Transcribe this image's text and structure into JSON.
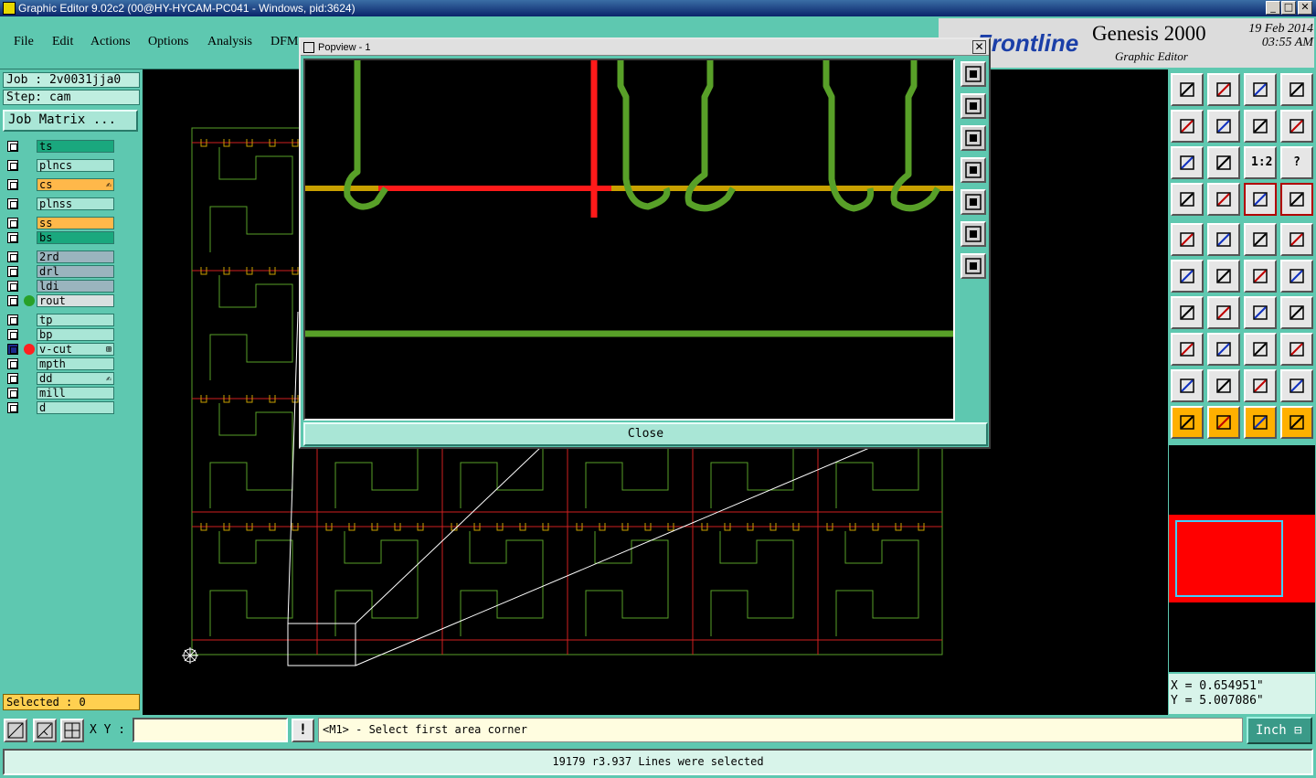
{
  "window": {
    "title": "Graphic Editor 9.02c2 (00@HY-HYCAM-PC041 - Windows, pid:3624)",
    "min_btn": "_",
    "max_btn": "□",
    "close_btn": "✕"
  },
  "menu": [
    "File",
    "Edit",
    "Actions",
    "Options",
    "Analysis",
    "DFM"
  ],
  "logo": {
    "brand": "Frontline",
    "product": "Genesis 2000",
    "subtitle": "Graphic Editor",
    "date": "19 Feb 2014",
    "time": "03:55 AM"
  },
  "job": {
    "job_line": "Job : 2v0031jja0",
    "step_line": "Step: cam",
    "matrix_button": "Job Matrix ..."
  },
  "layers": [
    {
      "name": "ts",
      "color": "#1aa87e",
      "dot": null,
      "flag": ""
    },
    {
      "name": "plncs",
      "color": "#a9e6d6",
      "dot": null,
      "flag": ""
    },
    {
      "name": "cs",
      "color": "#ffb84a",
      "dot": null,
      "flag": "✍"
    },
    {
      "name": "plnss",
      "color": "#a9e6d6",
      "dot": null,
      "flag": ""
    },
    {
      "name": "ss",
      "color": "#ffb84a",
      "dot": null,
      "flag": ""
    },
    {
      "name": "bs",
      "color": "#1aa87e",
      "dot": null,
      "flag": ""
    },
    {
      "name": "2rd",
      "color": "#9ab4be",
      "dot": null,
      "flag": ""
    },
    {
      "name": "drl",
      "color": "#9ab4be",
      "dot": null,
      "flag": ""
    },
    {
      "name": "ldi",
      "color": "#9ab4be",
      "dot": null,
      "flag": ""
    },
    {
      "name": "rout",
      "color": "#d8e0e0",
      "dot": "#28a028",
      "flag": ""
    },
    {
      "name": "tp",
      "color": "#a9e6d6",
      "dot": null,
      "flag": ""
    },
    {
      "name": "bp",
      "color": "#a9e6d6",
      "dot": null,
      "flag": ""
    },
    {
      "name": "v-cut",
      "color": "#a9e6d6",
      "dot": "#ff2020",
      "flag": "⊞"
    },
    {
      "name": "mpth",
      "color": "#a9e6d6",
      "dot": null,
      "flag": ""
    },
    {
      "name": "dd",
      "color": "#a9e6d6",
      "dot": null,
      "flag": "✍"
    },
    {
      "name": "mill",
      "color": "#a9e6d6",
      "dot": null,
      "flag": ""
    },
    {
      "name": "d",
      "color": "#a9e6d6",
      "dot": null,
      "flag": ""
    }
  ],
  "selected_label": "Selected : 0",
  "popview": {
    "title": "Popview - 1",
    "close_x": "✕",
    "close_button": "Close"
  },
  "coords": {
    "x": "X = 0.654951\"",
    "y": "Y = 5.007086\""
  },
  "bottom": {
    "xy_label": "X Y :",
    "xy_value": "",
    "bang": "!",
    "prompt": "<M1> - Select first area corner",
    "unit": "Inch ⊟"
  },
  "status": "19179 r3.937 Lines were selected",
  "tool_glyphs": [
    "1:2",
    "?"
  ],
  "colors": {
    "teal": "#5ec8b0",
    "trace_green": "#58a028",
    "vcut_red": "#ff2020",
    "orange_yellow": "#c8a000",
    "minimap_red": "#ff0000",
    "minimap_outline": "#40d0ff"
  }
}
